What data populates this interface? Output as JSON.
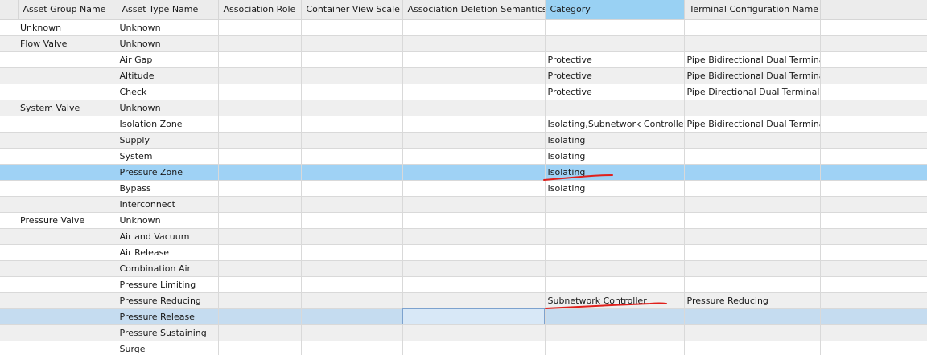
{
  "columns": [
    {
      "label": "Asset Group Name"
    },
    {
      "label": "Asset Type Name"
    },
    {
      "label": "Association Role"
    },
    {
      "label": "Container View Scale"
    },
    {
      "label": "Association Deletion Semantics"
    },
    {
      "label": "Category"
    },
    {
      "label": "Terminal Configuration Name"
    }
  ],
  "rows": [
    {
      "group": "Unknown",
      "type": "Unknown",
      "role": "",
      "scale": "",
      "deletion": "",
      "category": "",
      "terminal": ""
    },
    {
      "group": "Flow Valve",
      "type": "Unknown",
      "role": "",
      "scale": "",
      "deletion": "",
      "category": "",
      "terminal": ""
    },
    {
      "group": "",
      "type": "Air Gap",
      "role": "",
      "scale": "",
      "deletion": "",
      "category": "Protective",
      "terminal": "Pipe Bidirectional Dual Terminal"
    },
    {
      "group": "",
      "type": "Altitude",
      "role": "",
      "scale": "",
      "deletion": "",
      "category": "Protective",
      "terminal": "Pipe Bidirectional Dual Terminal"
    },
    {
      "group": "",
      "type": "Check",
      "role": "",
      "scale": "",
      "deletion": "",
      "category": "Protective",
      "terminal": "Pipe Directional Dual Terminal"
    },
    {
      "group": "System Valve",
      "type": "Unknown",
      "role": "",
      "scale": "",
      "deletion": "",
      "category": "",
      "terminal": ""
    },
    {
      "group": "",
      "type": "Isolation Zone",
      "role": "",
      "scale": "",
      "deletion": "",
      "category": "Isolating,Subnetwork Controller",
      "terminal": "Pipe Bidirectional Dual Terminal"
    },
    {
      "group": "",
      "type": "Supply",
      "role": "",
      "scale": "",
      "deletion": "",
      "category": "Isolating",
      "terminal": ""
    },
    {
      "group": "",
      "type": "System",
      "role": "",
      "scale": "",
      "deletion": "",
      "category": "Isolating",
      "terminal": ""
    },
    {
      "group": "",
      "type": "Pressure Zone",
      "role": "",
      "scale": "",
      "deletion": "",
      "category": "Isolating",
      "terminal": ""
    },
    {
      "group": "",
      "type": "Bypass",
      "role": "",
      "scale": "",
      "deletion": "",
      "category": "Isolating",
      "terminal": ""
    },
    {
      "group": "",
      "type": "Interconnect",
      "role": "",
      "scale": "",
      "deletion": "",
      "category": "",
      "terminal": ""
    },
    {
      "group": "Pressure Valve",
      "type": "Unknown",
      "role": "",
      "scale": "",
      "deletion": "",
      "category": "",
      "terminal": ""
    },
    {
      "group": "",
      "type": "Air and Vacuum",
      "role": "",
      "scale": "",
      "deletion": "",
      "category": "",
      "terminal": ""
    },
    {
      "group": "",
      "type": "Air Release",
      "role": "",
      "scale": "",
      "deletion": "",
      "category": "",
      "terminal": ""
    },
    {
      "group": "",
      "type": "Combination Air",
      "role": "",
      "scale": "",
      "deletion": "",
      "category": "",
      "terminal": ""
    },
    {
      "group": "",
      "type": "Pressure Limiting",
      "role": "",
      "scale": "",
      "deletion": "",
      "category": "",
      "terminal": ""
    },
    {
      "group": "",
      "type": "Pressure Reducing",
      "role": "",
      "scale": "",
      "deletion": "",
      "category": "Subnetwork Controller",
      "terminal": "Pressure Reducing"
    },
    {
      "group": "",
      "type": "Pressure Release",
      "role": "",
      "scale": "",
      "deletion": "",
      "category": "",
      "terminal": ""
    },
    {
      "group": "",
      "type": "Pressure Sustaining",
      "role": "",
      "scale": "",
      "deletion": "",
      "category": "",
      "terminal": ""
    },
    {
      "group": "",
      "type": "Surge",
      "role": "",
      "scale": "",
      "deletion": "",
      "category": "",
      "terminal": ""
    }
  ],
  "selected_row": "Pressure Zone",
  "current_row": "Pressure Release",
  "selected_column": "Category",
  "colors": {
    "header_bg": "#ececec",
    "header_selected": "#99d1f3",
    "row_selected": "#9fd2f5",
    "row_current": "#c5dcf0",
    "row_alt": "#efefef",
    "annotation_ink": "#e0201c"
  }
}
